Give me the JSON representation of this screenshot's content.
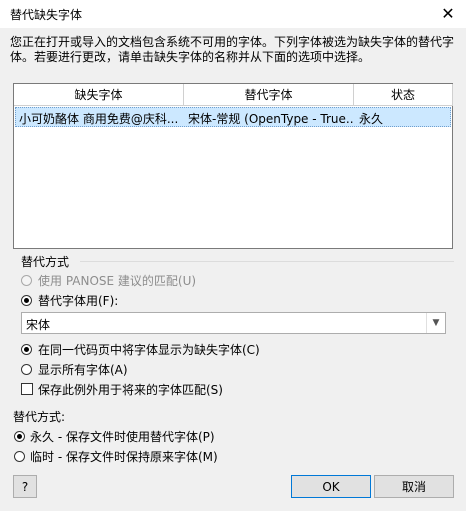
{
  "window": {
    "title": "替代缺失字体",
    "close_icon": "✕"
  },
  "description": "您正在打开或导入的文档包含系统不可用的字体。下列字体被选为缺失字体的替代字体。若要进行更改，请单击缺失字体的名称并从下面的选项中选择。",
  "table": {
    "columns": [
      "缺失字体",
      "替代字体",
      "状态"
    ],
    "rows": [
      {
        "missing": "小可奶酪体 商用免费@庆科...",
        "substitute": "宋体-常规 (OpenType - True...",
        "status": "永久"
      }
    ]
  },
  "replacement_group": {
    "title": "替代方式",
    "panose_label": "使用 PANOSE 建议的匹配(U)",
    "substitute_label": "替代字体用(F):",
    "font_combo_value": "宋体",
    "codepage_label": "在同一代码页中将字体显示为缺失字体(C)",
    "show_all_label": "显示所有字体(A)",
    "save_exception_label": "保存此例外用于将来的字体匹配(S)"
  },
  "substitution_mode": {
    "title": "替代方式:",
    "permanent_label": "永久 - 保存文件时使用替代字体(P)",
    "temporary_label": "临时 - 保存文件时保持原来字体(M)"
  },
  "buttons": {
    "help": "?",
    "ok": "OK",
    "cancel": "取消"
  }
}
